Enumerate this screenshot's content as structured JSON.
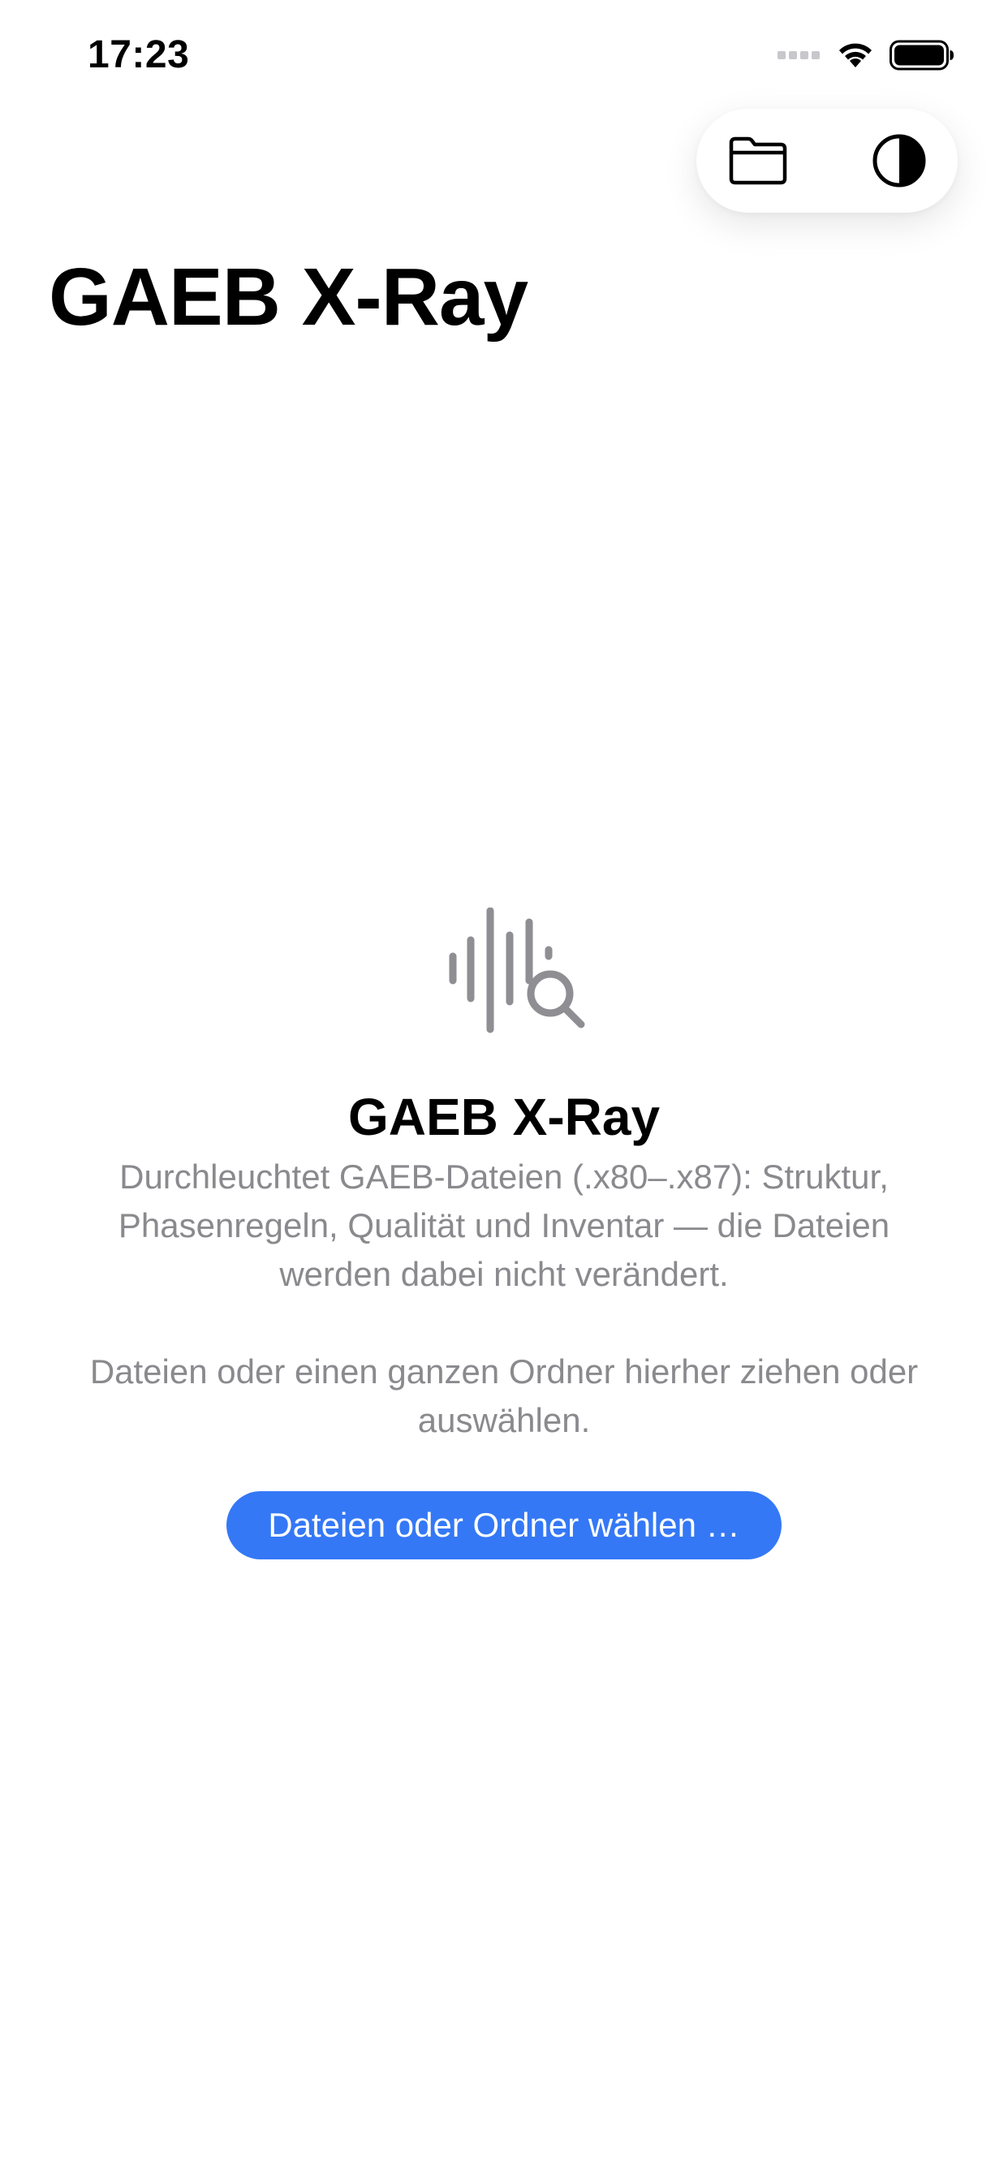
{
  "status_bar": {
    "time": "17:23"
  },
  "toolbar": {
    "open_icon": "folder-icon",
    "appearance_icon": "contrast-icon"
  },
  "header": {
    "title": "GAEB X-Ray"
  },
  "empty_state": {
    "icon": "waveform-magnifyingglass-icon",
    "title": "GAEB X-Ray",
    "description": "Durchleuchtet GAEB-Dateien (.x80–.x87): Struktur, Phasenregeln, Qualität und Inventar — die Dateien werden dabei nicht verändert.",
    "hint": "Dateien oder einen ganzen Ordner hierher ziehen oder auswählen.",
    "button_label": "Dateien oder Ordner wählen …"
  },
  "colors": {
    "accent": "#3478f6",
    "secondary_text": "#8a8a8e",
    "icon_gray": "#8e8e93"
  }
}
